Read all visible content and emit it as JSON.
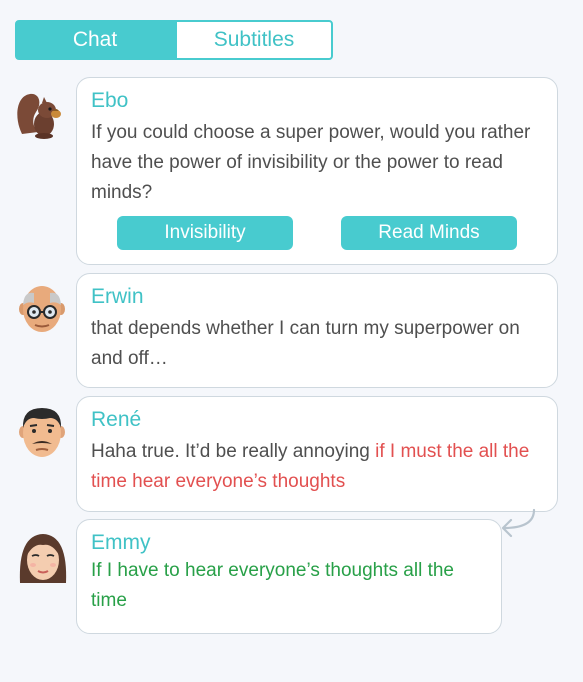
{
  "tabs": {
    "chat": "Chat",
    "subtitles": "Subtitles"
  },
  "messages": [
    {
      "name": "Ebo",
      "avatar": "squirrel-avatar",
      "text": "If you could choose a super power, would you rather have the power of invisibility or the power to read minds?",
      "choices": [
        "Invisibility",
        "Read Minds"
      ]
    },
    {
      "name": "Erwin",
      "avatar": "old-man-avatar",
      "text": "that depends whether I can turn my superpower on and off…"
    },
    {
      "name": "René",
      "avatar": "man-avatar",
      "text_plain": "Haha true. It’d be really annoying ",
      "text_removed": "if I must the all the time hear everyone’s thoughts"
    },
    {
      "name": "Emmy",
      "avatar": "woman-avatar",
      "text_corrected": "If I have to hear everyone’s thoughts all the time"
    }
  ],
  "icons": {
    "reply": "reply-arrow-icon"
  },
  "colors": {
    "accent": "#48cbcf",
    "removed_text": "#e25050",
    "corrected_text": "#28a048",
    "border": "#cfd8df"
  }
}
